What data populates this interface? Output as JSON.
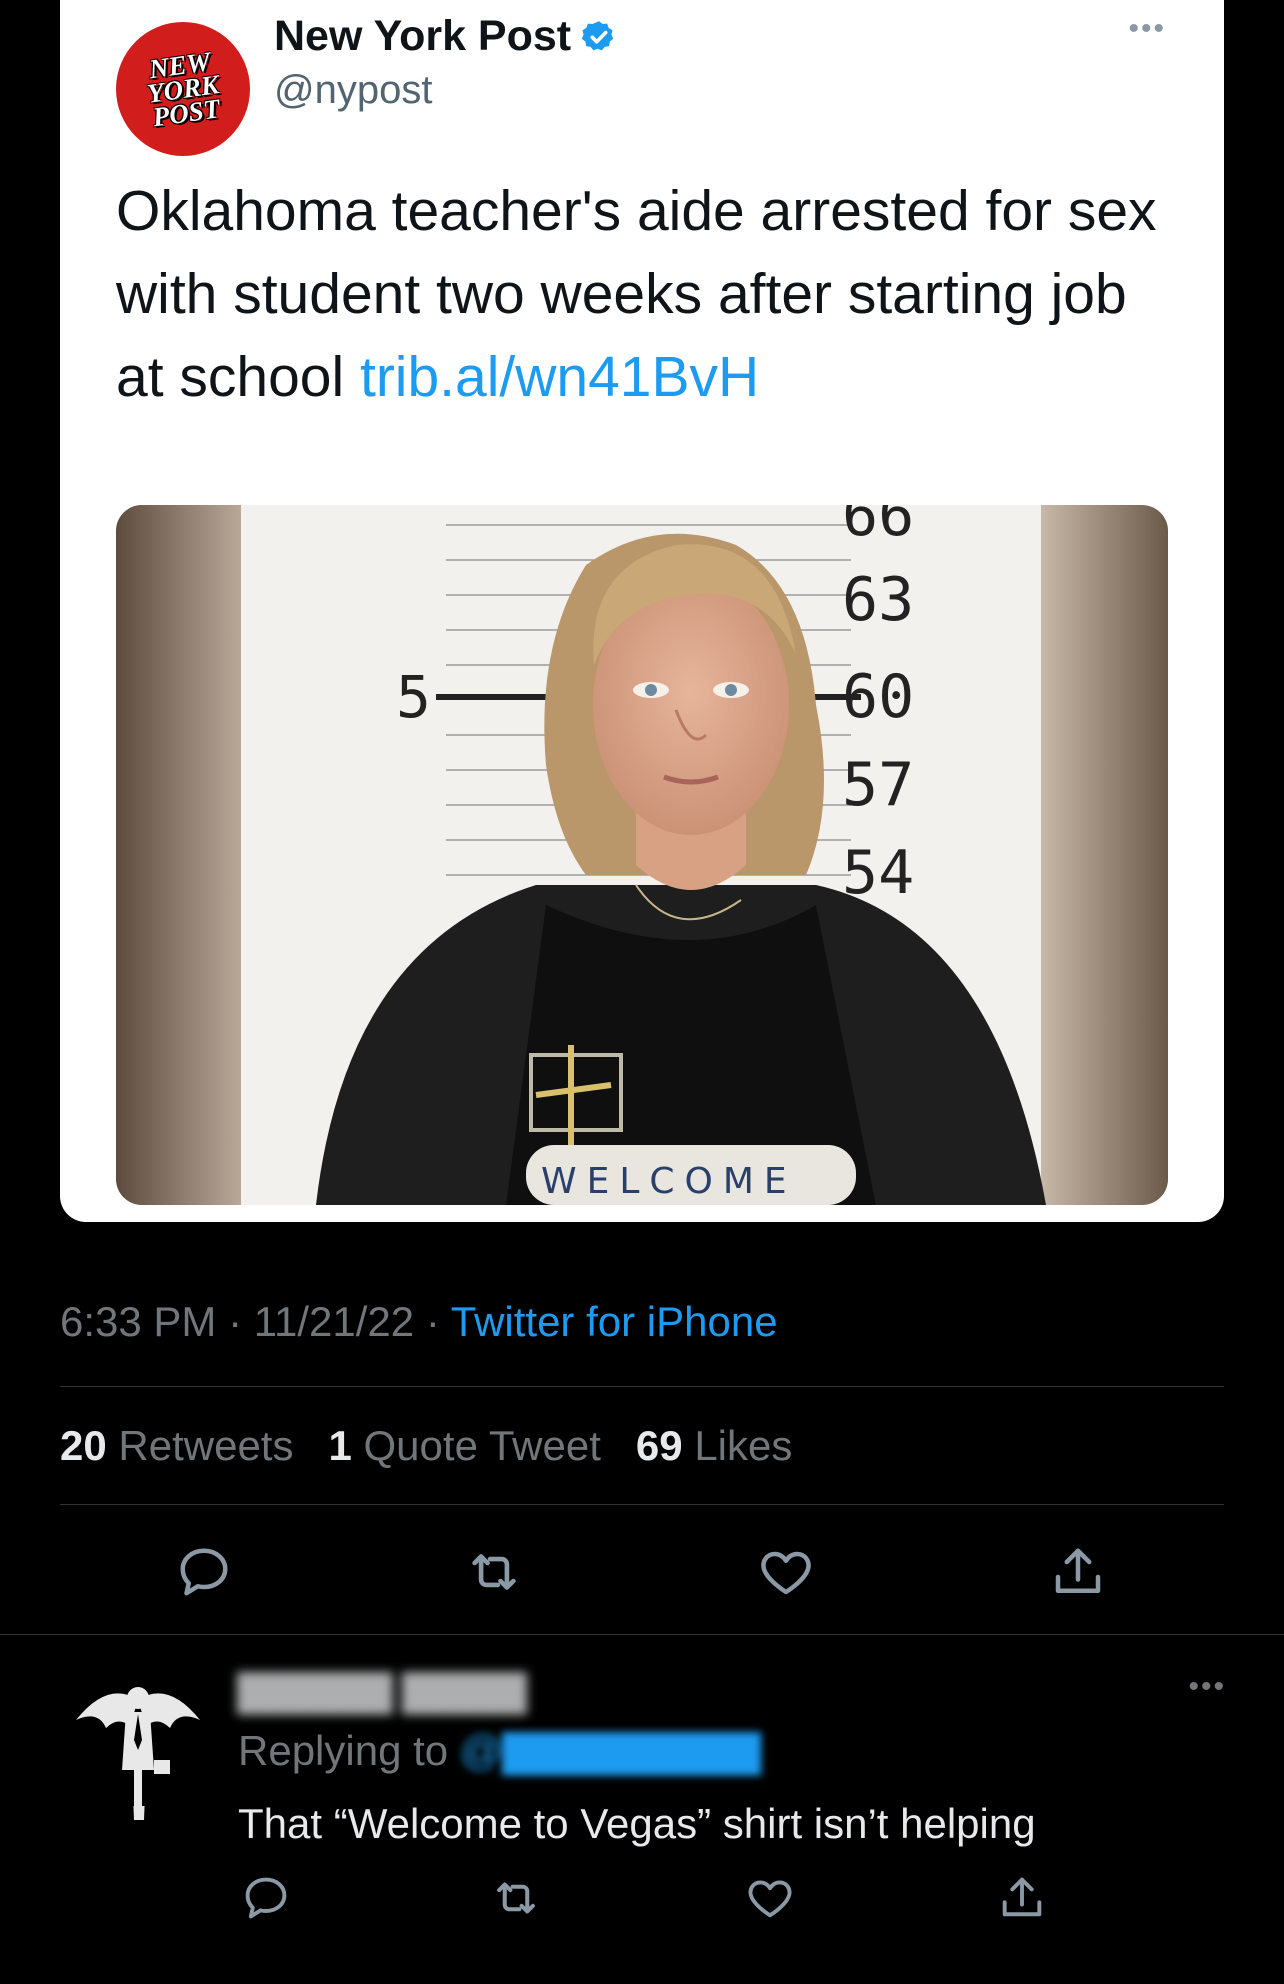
{
  "tweet": {
    "avatar_logo_lines": [
      "NEW",
      "YORK",
      "POST"
    ],
    "display_name": "New York Post",
    "handle": "@nypost",
    "text": "Oklahoma teacher's aide arrested for sex with student two weeks after starting job at school",
    "link": "trib.al/wn41BvH",
    "photo": {
      "height_ruler_labels": [
        "66",
        "63",
        "60",
        "57",
        "54"
      ],
      "height_marker": "5",
      "shirt_text": "WELCOME"
    },
    "time": "6:33 PM",
    "date": "11/21/22",
    "source": "Twitter for iPhone",
    "separator": "·",
    "stats": {
      "retweets_count": "20",
      "retweets_label": "Retweets",
      "quotes_count": "1",
      "quotes_label": "Quote Tweet",
      "likes_count": "69",
      "likes_label": "Likes"
    }
  },
  "reply": {
    "replying_label": "Replying to",
    "text": "That “Welcome to Vegas” shirt isn’t helping"
  },
  "icons": {
    "verified": "verified-badge-icon",
    "more": "more-options-icon",
    "reply": "reply-icon",
    "retweet": "retweet-icon",
    "like": "like-icon",
    "share": "share-icon"
  },
  "colors": {
    "background": "#000000",
    "card": "#ffffff",
    "link": "#1d9bf0",
    "logo_red": "#d21d1d",
    "muted": "#71767b"
  }
}
